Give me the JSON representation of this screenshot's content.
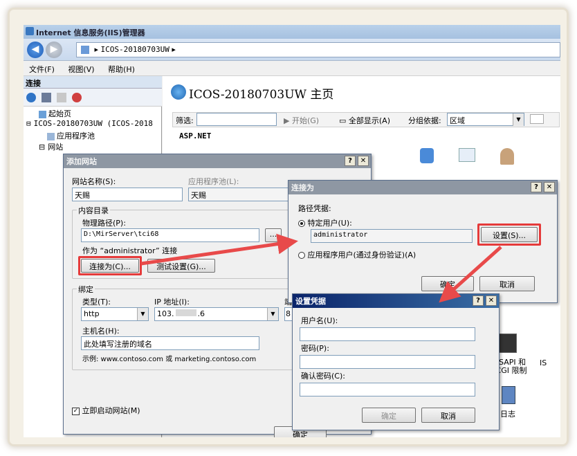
{
  "window": {
    "title": "Internet 信息服务(IIS)管理器"
  },
  "address": {
    "path": "ICOS-20180703UW",
    "sep": "▸"
  },
  "menu": [
    "文件(F)",
    "视图(V)",
    "帮助(H)"
  ],
  "left_pane": {
    "header": "连接",
    "tree": [
      "起始页",
      "ICOS-20180703UW (ICOS-2018",
      "应用程序池",
      "网站"
    ]
  },
  "right_pane": {
    "title": "ICOS-20180703UW 主页",
    "filter_label": "筛选:",
    "start_label": "开始(G)",
    "show_all_label": "全部显示(A)",
    "group_by_label": "分组依据:",
    "group_by_value": "区域",
    "section": "ASP.NET",
    "features": [
      {
        "label": "ISAPI 和\nCGI 限制"
      },
      {
        "label": "IS"
      },
      {
        "label": "日志"
      }
    ]
  },
  "add_site": {
    "title": "添加网站",
    "site_name_label": "网站名称(S):",
    "site_name_value": "天赐",
    "app_pool_label": "应用程序池(L):",
    "app_pool_value": "天赐",
    "content_legend": "内容目录",
    "phys_path_label": "物理路径(P):",
    "phys_path_value": "D:\\MirServer\\tci68",
    "browse_label": "...",
    "connect_as_info": "作为 “administrator” 连接",
    "connect_as_btn": "连接为(C)...",
    "test_btn": "测试设置(G)...",
    "binding_legend": "绑定",
    "type_label": "类型(T):",
    "type_value": "http",
    "ip_label": "IP 地址(I):",
    "ip_value": "103.",
    "ip_value_end": ".6",
    "port_label": "端",
    "port_value": "8",
    "host_label": "主机名(H):",
    "host_value": "此处填写注册的域名",
    "example": "示例: www.contoso.com 或 marketing.contoso.com",
    "start_site": "立即启动网站(M)",
    "ok": "确定"
  },
  "connect_as": {
    "title": "连接为",
    "path_cred": "路径凭据:",
    "specific_user": "特定用户(U):",
    "user_value": "administrator",
    "set_btn": "设置(S)...",
    "app_user": "应用程序用户(通过身份验证)(A)",
    "ok": "确定",
    "cancel": "取消"
  },
  "set_cred": {
    "title": "设置凭据",
    "user_label": "用户名(U):",
    "pwd_label": "密码(P):",
    "confirm_label": "确认密码(C):",
    "ok": "确定",
    "cancel": "取消"
  },
  "title_buttons": {
    "help": "?",
    "close": "✕"
  },
  "colors": {
    "highlight": "#e53a3a",
    "arrow": "#e84a4a",
    "active_title": "#0a246a"
  }
}
